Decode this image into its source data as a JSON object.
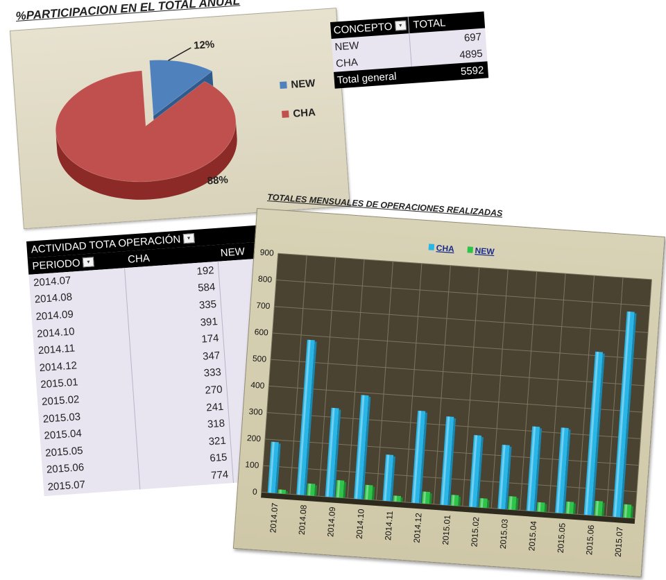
{
  "pie_title": "%PARTICIPACION EN EL TOTAL ANUAL",
  "colors": {
    "NEW": "#4f81bd",
    "CHA": "#c0504d",
    "bar_cha": "#29b6e6",
    "bar_new": "#2ec44a",
    "plot_bg": "#4a4331"
  },
  "total_table": {
    "headers": [
      "CONCEPTO",
      "TOTAL"
    ],
    "rows": [
      {
        "label": "NEW",
        "value": "697"
      },
      {
        "label": "CHA",
        "value": "4895"
      }
    ],
    "footer": {
      "label": "Total general",
      "value": "5592"
    }
  },
  "activity_table": {
    "header_top": "ACTIVIDAD TOTA OPERACIÓN",
    "header_left": "PERIODO",
    "cols": [
      "CHA",
      "NEW"
    ],
    "rows": [
      {
        "periodo": "2014.07",
        "cha": "192"
      },
      {
        "periodo": "2014.08",
        "cha": "584"
      },
      {
        "periodo": "2014.09",
        "cha": "335"
      },
      {
        "periodo": "2014.10",
        "cha": "391"
      },
      {
        "periodo": "2014.11",
        "cha": "174"
      },
      {
        "periodo": "2014.12",
        "cha": "347"
      },
      {
        "periodo": "2015.01",
        "cha": "333"
      },
      {
        "periodo": "2015.02",
        "cha": "270"
      },
      {
        "periodo": "2015.03",
        "cha": "241"
      },
      {
        "periodo": "2015.04",
        "cha": "318"
      },
      {
        "periodo": "2015.05",
        "cha": "321"
      },
      {
        "periodo": "2015.06",
        "cha": "615"
      },
      {
        "periodo": "2015.07",
        "cha": "774"
      }
    ]
  },
  "chart_data": [
    {
      "type": "pie",
      "title": "%PARTICIPACION EN EL TOTAL ANUAL",
      "categories": [
        "NEW",
        "CHA"
      ],
      "values": [
        12,
        88
      ],
      "labels": [
        "12%",
        "88%"
      ],
      "legend": "right"
    },
    {
      "type": "bar",
      "title": "TOTALES MENSUALES DE OPERACIONES REALIZADAS",
      "categories": [
        "2014.07",
        "2014.08",
        "2014.09",
        "2014.10",
        "2014.11",
        "2014.12",
        "2015.01",
        "2015.02",
        "2015.03",
        "2015.04",
        "2015.05",
        "2015.06",
        "2015.07"
      ],
      "series": [
        {
          "name": "CHA",
          "values": [
            192,
            584,
            335,
            391,
            174,
            347,
            333,
            270,
            241,
            318,
            321,
            615,
            774
          ]
        },
        {
          "name": "NEW",
          "values": [
            15,
            45,
            65,
            55,
            22,
            45,
            40,
            35,
            50,
            35,
            45,
            55,
            50
          ]
        }
      ],
      "ylim": [
        0,
        900
      ],
      "yticks": [
        "0",
        "100",
        "200",
        "300",
        "400",
        "500",
        "600",
        "700",
        "800",
        "900"
      ],
      "grid": true,
      "legend": "top"
    }
  ]
}
